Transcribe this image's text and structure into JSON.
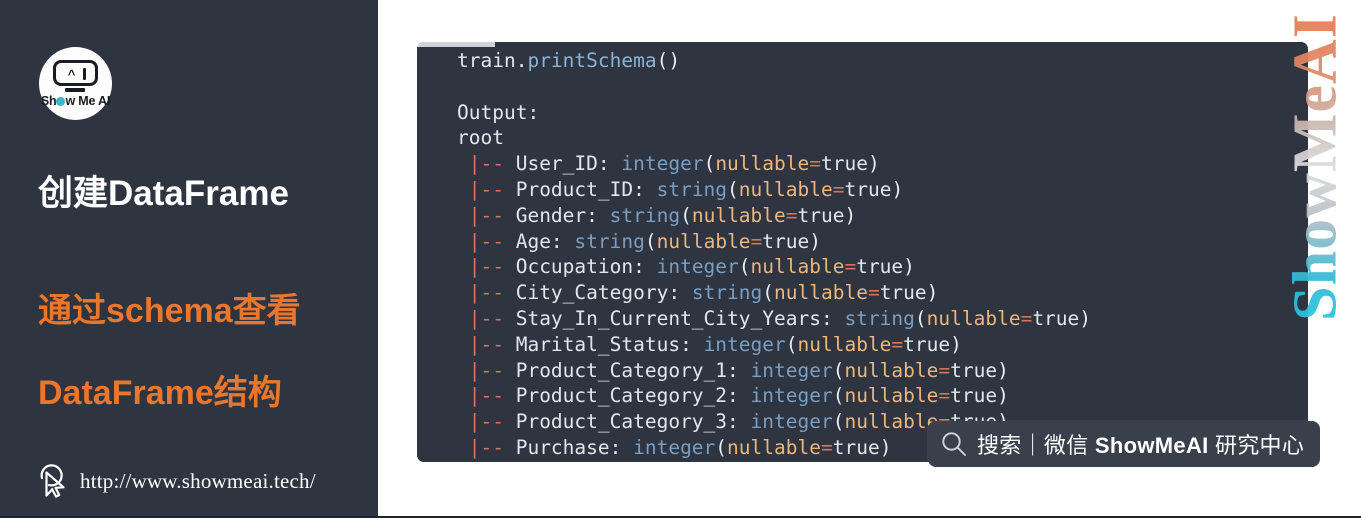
{
  "sidebar": {
    "logo": {
      "name": "show-me-ai-logo",
      "brand_before": "Sh",
      "brand_after": "w Me AI",
      "screen_glyph_a": "^",
      "accent_color": "#3bb4c9"
    },
    "title": "创建DataFrame",
    "subtitle_line1": "通过schema查看",
    "subtitle_line2": "DataFrame结构",
    "url": "http://www.showmeai.tech/",
    "background_color": "#2e3440",
    "accent_color": "#e8762c"
  },
  "code_block": {
    "language": "python",
    "background_color": "#2e3440",
    "lines": [
      {
        "segments": [
          {
            "t": "train.",
            "c": "plain"
          },
          {
            "t": "printSchema",
            "c": "fn"
          },
          {
            "t": "()",
            "c": "paren"
          }
        ]
      },
      {
        "segments": []
      },
      {
        "segments": [
          {
            "t": "Output:",
            "c": "plain"
          }
        ]
      },
      {
        "segments": [
          {
            "t": "root",
            "c": "plain"
          }
        ]
      },
      {
        "segments": [
          {
            "t": " |",
            "c": "bar"
          },
          {
            "t": "--",
            "c": "dash"
          },
          {
            "t": " User_ID: ",
            "c": "plain"
          },
          {
            "t": "integer",
            "c": "type"
          },
          {
            "t": "(",
            "c": "paren"
          },
          {
            "t": "nullable",
            "c": "attr"
          },
          {
            "t": "=",
            "c": "dash"
          },
          {
            "t": "true",
            "c": "plain"
          },
          {
            "t": ")",
            "c": "paren"
          }
        ]
      },
      {
        "segments": [
          {
            "t": " |",
            "c": "bar"
          },
          {
            "t": "--",
            "c": "dash"
          },
          {
            "t": " Product_ID: ",
            "c": "plain"
          },
          {
            "t": "string",
            "c": "type"
          },
          {
            "t": "(",
            "c": "paren"
          },
          {
            "t": "nullable",
            "c": "attr"
          },
          {
            "t": "=",
            "c": "dash"
          },
          {
            "t": "true",
            "c": "plain"
          },
          {
            "t": ")",
            "c": "paren"
          }
        ]
      },
      {
        "segments": [
          {
            "t": " |",
            "c": "bar"
          },
          {
            "t": "--",
            "c": "dash"
          },
          {
            "t": " Gender: ",
            "c": "plain"
          },
          {
            "t": "string",
            "c": "type"
          },
          {
            "t": "(",
            "c": "paren"
          },
          {
            "t": "nullable",
            "c": "attr"
          },
          {
            "t": "=",
            "c": "dash"
          },
          {
            "t": "true",
            "c": "plain"
          },
          {
            "t": ")",
            "c": "paren"
          }
        ]
      },
      {
        "segments": [
          {
            "t": " |",
            "c": "bar"
          },
          {
            "t": "--",
            "c": "dash"
          },
          {
            "t": " Age: ",
            "c": "plain"
          },
          {
            "t": "string",
            "c": "type"
          },
          {
            "t": "(",
            "c": "paren"
          },
          {
            "t": "nullable",
            "c": "attr"
          },
          {
            "t": "=",
            "c": "dash"
          },
          {
            "t": "true",
            "c": "plain"
          },
          {
            "t": ")",
            "c": "paren"
          }
        ]
      },
      {
        "segments": [
          {
            "t": " |",
            "c": "bar"
          },
          {
            "t": "--",
            "c": "dash"
          },
          {
            "t": " Occupation: ",
            "c": "plain"
          },
          {
            "t": "integer",
            "c": "type"
          },
          {
            "t": "(",
            "c": "paren"
          },
          {
            "t": "nullable",
            "c": "attr"
          },
          {
            "t": "=",
            "c": "dash"
          },
          {
            "t": "true",
            "c": "plain"
          },
          {
            "t": ")",
            "c": "paren"
          }
        ]
      },
      {
        "segments": [
          {
            "t": " |",
            "c": "bar"
          },
          {
            "t": "--",
            "c": "dash"
          },
          {
            "t": " City_Category: ",
            "c": "plain"
          },
          {
            "t": "string",
            "c": "type"
          },
          {
            "t": "(",
            "c": "paren"
          },
          {
            "t": "nullable",
            "c": "attr"
          },
          {
            "t": "=",
            "c": "dash"
          },
          {
            "t": "true",
            "c": "plain"
          },
          {
            "t": ")",
            "c": "paren"
          }
        ]
      },
      {
        "segments": [
          {
            "t": " |",
            "c": "bar"
          },
          {
            "t": "--",
            "c": "dash"
          },
          {
            "t": " Stay_In_Current_City_Years: ",
            "c": "plain"
          },
          {
            "t": "string",
            "c": "type"
          },
          {
            "t": "(",
            "c": "paren"
          },
          {
            "t": "nullable",
            "c": "attr"
          },
          {
            "t": "=",
            "c": "dash"
          },
          {
            "t": "true",
            "c": "plain"
          },
          {
            "t": ")",
            "c": "paren"
          }
        ]
      },
      {
        "segments": [
          {
            "t": " |",
            "c": "bar"
          },
          {
            "t": "--",
            "c": "dash"
          },
          {
            "t": " Marital_Status: ",
            "c": "plain"
          },
          {
            "t": "integer",
            "c": "type"
          },
          {
            "t": "(",
            "c": "paren"
          },
          {
            "t": "nullable",
            "c": "attr"
          },
          {
            "t": "=",
            "c": "dash"
          },
          {
            "t": "true",
            "c": "plain"
          },
          {
            "t": ")",
            "c": "paren"
          }
        ]
      },
      {
        "segments": [
          {
            "t": " |",
            "c": "bar"
          },
          {
            "t": "--",
            "c": "dash"
          },
          {
            "t": " Product_Category_1: ",
            "c": "plain"
          },
          {
            "t": "integer",
            "c": "type"
          },
          {
            "t": "(",
            "c": "paren"
          },
          {
            "t": "nullable",
            "c": "attr"
          },
          {
            "t": "=",
            "c": "dash"
          },
          {
            "t": "true",
            "c": "plain"
          },
          {
            "t": ")",
            "c": "paren"
          }
        ]
      },
      {
        "segments": [
          {
            "t": " |",
            "c": "bar"
          },
          {
            "t": "--",
            "c": "dash"
          },
          {
            "t": " Product_Category_2: ",
            "c": "plain"
          },
          {
            "t": "integer",
            "c": "type"
          },
          {
            "t": "(",
            "c": "paren"
          },
          {
            "t": "nullable",
            "c": "attr"
          },
          {
            "t": "=",
            "c": "dash"
          },
          {
            "t": "true",
            "c": "plain"
          },
          {
            "t": ")",
            "c": "paren"
          }
        ]
      },
      {
        "segments": [
          {
            "t": " |",
            "c": "bar"
          },
          {
            "t": "--",
            "c": "dash"
          },
          {
            "t": " Product_Category_3: ",
            "c": "plain"
          },
          {
            "t": "integer",
            "c": "type"
          },
          {
            "t": "(",
            "c": "paren"
          },
          {
            "t": "nullable",
            "c": "attr"
          },
          {
            "t": "=",
            "c": "dash"
          },
          {
            "t": "true",
            "c": "plain"
          },
          {
            "t": ")",
            "c": "paren"
          }
        ]
      },
      {
        "segments": [
          {
            "t": " |",
            "c": "bar"
          },
          {
            "t": "--",
            "c": "dash"
          },
          {
            "t": " Purchase: ",
            "c": "plain"
          },
          {
            "t": "integer",
            "c": "type"
          },
          {
            "t": "(",
            "c": "paren"
          },
          {
            "t": "nullable",
            "c": "attr"
          },
          {
            "t": "=",
            "c": "dash"
          },
          {
            "t": "true",
            "c": "plain"
          },
          {
            "t": ")",
            "c": "paren"
          }
        ]
      }
    ]
  },
  "vertical_watermark": {
    "text": "ShowMeAI"
  },
  "search_watermark": {
    "icon": "search-icon",
    "text_plain": "搜索｜微信 ",
    "text_bold": "ShowMeAI",
    "text_tail": " 研究中心"
  }
}
